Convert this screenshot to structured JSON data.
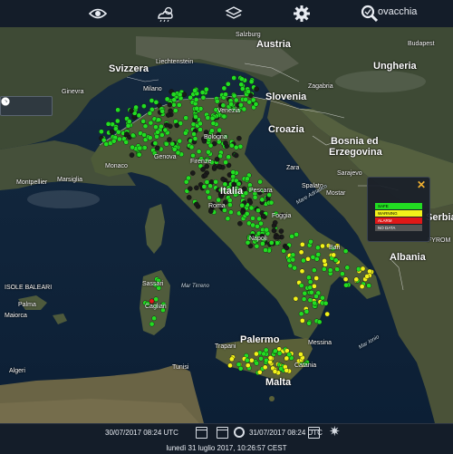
{
  "toolbar": {
    "icons": [
      "eye-icon",
      "weather-icon",
      "layers-icon",
      "gear-icon",
      "search-icon"
    ],
    "search_overlay_text": "ovacchia"
  },
  "map": {
    "labels": {
      "austria": "Austria",
      "svizzera": "Svizzera",
      "liechtenstein": "Liechtenstein",
      "salzburg": "Salzburg",
      "ungheria": "Ungheria",
      "slovenia": "Slovenia",
      "croazia": "Croazia",
      "bosnia1": "Bosnia ed",
      "bosnia2": "Erzegovina",
      "albania": "Albania",
      "ginevra": "Ginevra",
      "monaco": "Monaco",
      "marsiglia": "Marsiglia",
      "montpellier": "Montpellier",
      "baleari": "ISOLE BALEARI",
      "palma": "Palma",
      "maiorca": "Maiorca",
      "algeri": "Algeri",
      "tunisi": "Tunisi",
      "palermo": "Palermo",
      "trapani": "Trapani",
      "malta": "Malta",
      "napoli": "Napoli",
      "bari": "Bari",
      "cagliari": "Cagliari",
      "sassari": "Sassari",
      "venezia": "Venezia",
      "zagabria": "Zagabria",
      "budapest": "Budapest",
      "mar_tirreno": "Mar Tirreno",
      "mar_adriatico": "Mare Adriatico",
      "mar_ionio": "Mar Ionio",
      "italia": "Italia",
      "roma": "Roma",
      "genova": "Genova",
      "firenze": "Firenze",
      "milano": "Milano",
      "bologna": "Bologna",
      "pescara": "Pescara",
      "foggia": "Foggia",
      "catania": "Catania",
      "messina": "Messina",
      "serbia": "Serbia",
      "fyrom": "FYROM",
      "sarajevo": "Sarajevo",
      "mostar": "Mostar",
      "spalato": "Spalato",
      "zara": "Zara"
    }
  },
  "legend": {
    "close_label": "✕",
    "items": [
      {
        "label": "SAFE",
        "color": "#22dd22"
      },
      {
        "label": "WARNING",
        "color": "#f2f21a"
      },
      {
        "label": "ALARM",
        "color": "#e01818"
      },
      {
        "label": "NO DATA",
        "color": "#555555"
      }
    ]
  },
  "footer": {
    "start_date": "30/07/2017 08:24 UTC",
    "end_date": "31/07/2017 08:24 UTC",
    "current_time": "lunedì 31 luglio 2017, 10:26:57 CEST"
  },
  "status_colors": {
    "safe": "#22dd22",
    "warning": "#f2f21a",
    "alarm": "#e01818",
    "nodata": "#1a1a1a"
  }
}
